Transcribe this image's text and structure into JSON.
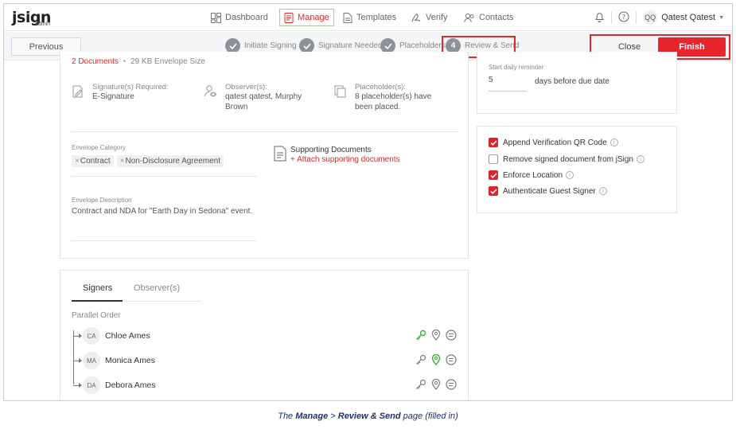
{
  "app": {
    "logo": "jsign",
    "logo_sub": "admin"
  },
  "nav": {
    "items": [
      {
        "label": "Dashboard",
        "icon": "dashboard-icon"
      },
      {
        "label": "Manage",
        "icon": "manage-icon",
        "active": true
      },
      {
        "label": "Templates",
        "icon": "templates-icon"
      },
      {
        "label": "Verify",
        "icon": "verify-icon"
      },
      {
        "label": "Contacts",
        "icon": "contacts-icon"
      }
    ],
    "user_initials": "QQ",
    "user_name": "Qatest Qatest"
  },
  "stepbar": {
    "previous": "Previous",
    "steps": [
      {
        "label": "Initiate Signing",
        "state": "done"
      },
      {
        "label": "Signature Needed",
        "state": "done"
      },
      {
        "label": "Placeholders",
        "state": "done"
      },
      {
        "label": "Review & Send",
        "state": "current",
        "number": "4"
      }
    ],
    "close": "Close",
    "finish": "Finish"
  },
  "summary": {
    "documents_link": "2 Documents",
    "envelope_size": "29 KB Envelope Size",
    "signature_label": "Signature(s) Required:",
    "signature_value": "E-Signature",
    "observer_label": "Observer(s):",
    "observer_value_1": "qatest qatest, Murphy",
    "observer_value_2": "Brown",
    "placeholder_label": "Placeholder(s):",
    "placeholder_value_1": "8 placeholder(s) have",
    "placeholder_value_2": "been placed."
  },
  "envelope": {
    "category_label": "Envelope Category",
    "categories": [
      "Contract",
      "Non-Disclosure Agreement"
    ],
    "supporting_title": "Supporting Documents",
    "supporting_link": "+ Attach supporting documents",
    "description_label": "Envelope Description",
    "description": "Contract and NDA for \"Earth Day in Sedona\" event."
  },
  "reminder": {
    "label": "Start daily reminder",
    "days": "5",
    "suffix": "days before due date"
  },
  "options": [
    {
      "label": "Append Verification QR Code",
      "checked": true
    },
    {
      "label": "Remove signed document from jSign",
      "checked": false
    },
    {
      "label": "Enforce Location",
      "checked": true
    },
    {
      "label": "Authenticate Guest Signer",
      "checked": true
    }
  ],
  "signers_panel": {
    "tabs": [
      "Signers",
      "Observer(s)"
    ],
    "order_label": "Parallel Order",
    "signers": [
      {
        "initials": "CA",
        "name": "Chloe Ames",
        "key_color": "#3bb33b",
        "pin_color": "#777777"
      },
      {
        "initials": "MA",
        "name": "Monica Ames",
        "key_color": "#777777",
        "pin_color": "#3bb33b"
      },
      {
        "initials": "DA",
        "name": "Debora Ames",
        "key_color": "#777777",
        "pin_color": "#777777"
      }
    ]
  },
  "caption": {
    "prefix": "The ",
    "manage": "Manage",
    "arrow": " > ",
    "review": "Review & Send",
    "suffix": " page (filled in)"
  },
  "colors": {
    "accent": "#e6252d",
    "highlight": "#e02a2a",
    "green": "#3bb33b"
  }
}
